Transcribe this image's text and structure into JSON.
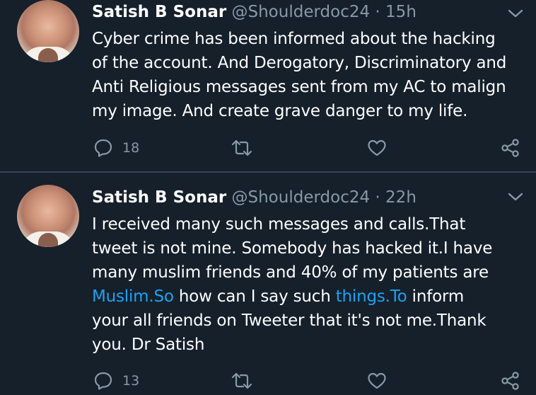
{
  "tweets": [
    {
      "author_name": "Satish B Sonar",
      "handle": "@Shoulderdoc24",
      "separator": "·",
      "time": "15h",
      "lines": [
        "Cyber crime has been informed about the hacking",
        "of the account. And Derogatory, Discriminatory and",
        "Anti Religious messages sent from my AC to malign",
        "my image. And create grave danger to my life."
      ],
      "reply_count": "18"
    },
    {
      "author_name": "Satish B Sonar",
      "handle": "@Shoulderdoc24",
      "separator": "·",
      "time": "22h",
      "line1": "I received many such messages and calls.That",
      "line2": "tweet is not mine. Somebody has hacked it.I have",
      "line3": "many muslim friends and 40% of my patients are",
      "line4_link1": "Muslim.So",
      "line4_mid": " how can I say such ",
      "line4_link2": "things.To",
      "line4_end": " inform",
      "line5": "your all friends on Tweeter that it's not me.Thank",
      "line6": "you. Dr Satish",
      "reply_count": "13"
    }
  ],
  "colors": {
    "background": "#15202b",
    "text": "#ffffff",
    "secondary": "#8899a6",
    "link": "#1da1f2",
    "divider": "#38444d"
  },
  "icons": [
    "reply-icon",
    "retweet-icon",
    "like-icon",
    "share-icon",
    "chevron-down-icon"
  ]
}
